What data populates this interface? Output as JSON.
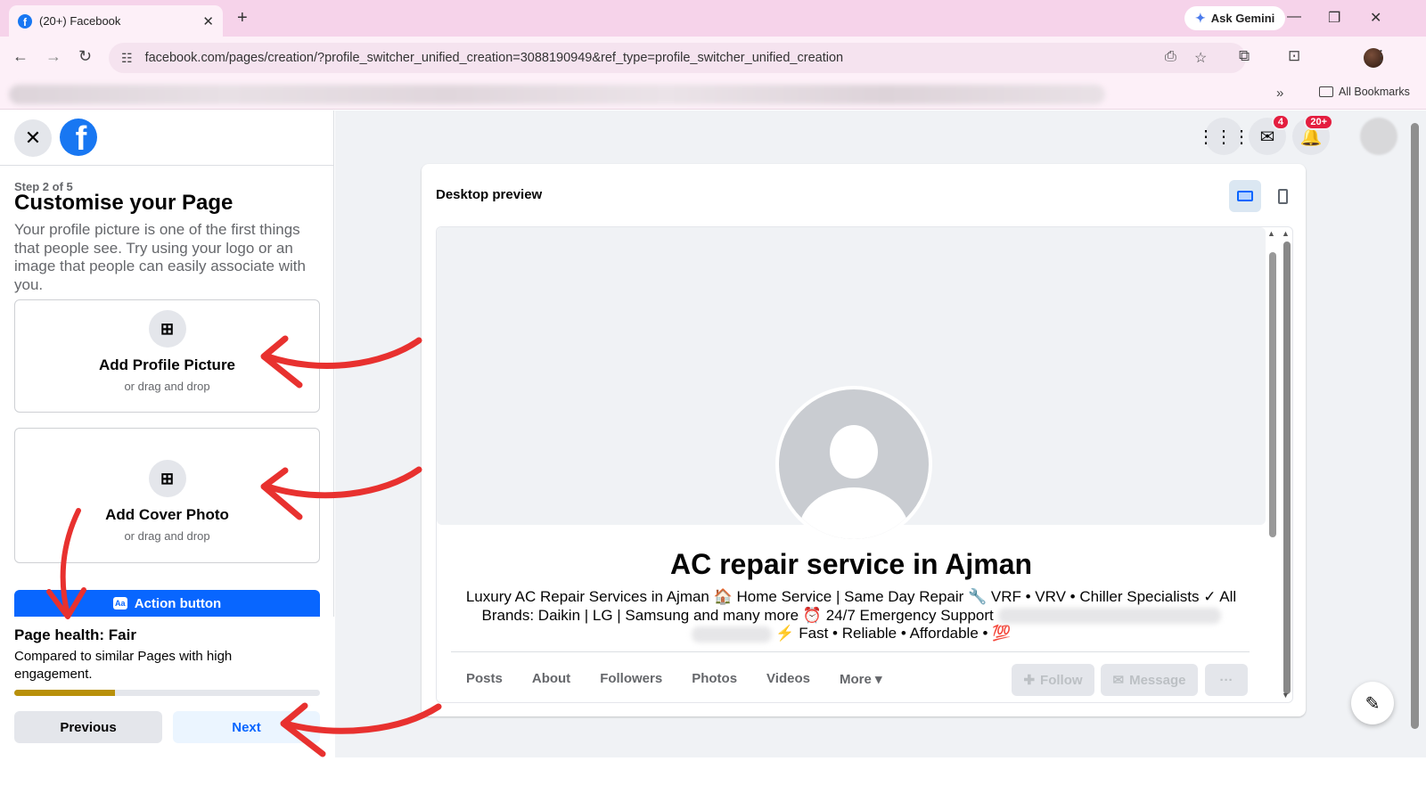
{
  "browser": {
    "tab_title": "(20+) Facebook",
    "tab_close": "✕",
    "new_tab": "+",
    "gemini_label": "Ask Gemini",
    "url": "facebook.com/pages/creation/?profile_switcher_unified_creation=3088190949&ref_type=profile_switcher_unified_creation",
    "all_bookmarks": "All Bookmarks",
    "bookmarks_more": "»"
  },
  "left_panel": {
    "step": "Step 2 of 5",
    "title": "Customise your Page",
    "description": "Your profile picture is one of the first things that people see. Try using your logo or an image that people can easily associate with you.",
    "profile_card": {
      "title": "Add Profile Picture",
      "subtitle": "or drag and drop"
    },
    "cover_card": {
      "title": "Add Cover Photo",
      "subtitle": "or drag and drop"
    },
    "action_button": "Action button",
    "health": {
      "title": "Page health: Fair",
      "description": "Compared to similar Pages with high engagement.",
      "progress": 0.33
    },
    "previous": "Previous",
    "next": "Next"
  },
  "top_icons": {
    "messenger_badge": "4",
    "notifications_badge": "20+"
  },
  "preview": {
    "label": "Desktop preview",
    "page_name": "AC repair service in Ajman",
    "bio_line1": "Luxury AC Repair Services in Ajman 🏠 Home Service | Same Day Repair 🔧 VRF • VRV • Chiller Specialists ✓ All",
    "bio_line2": "Brands: Daikin | LG | Samsung and many more ⏰ 24/7 Emergency Support",
    "bio_line3": "⚡ Fast • Reliable • Affordable • 💯",
    "tabs": [
      "Posts",
      "About",
      "Followers",
      "Photos",
      "Videos",
      "More"
    ],
    "follow": "Follow",
    "message": "Message",
    "more_dots": "···"
  },
  "colors": {
    "facebook_blue": "#1877f2",
    "action_blue": "#0866ff",
    "health_fill": "#b8900a",
    "annotation_red": "#e8312f",
    "tab_bar": "#f6d3ea"
  }
}
